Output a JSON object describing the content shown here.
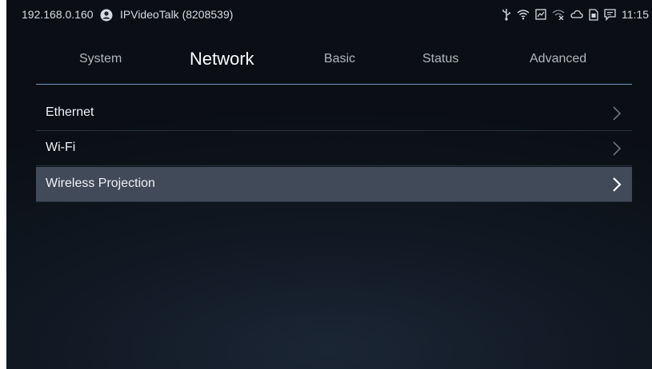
{
  "status_bar": {
    "ip": "192.168.0.160",
    "account_icon": "account-circle-icon",
    "account_label": "IPVideoTalk (8208539)",
    "tray_icons": [
      "usb-icon",
      "wifi-icon",
      "screenshot-icon",
      "wifi-off-icon",
      "cloud-icon",
      "sim-card-icon",
      "message-icon"
    ],
    "time": "11:15"
  },
  "tabs": [
    {
      "label": "System",
      "active": false
    },
    {
      "label": "Network",
      "active": true
    },
    {
      "label": "Basic",
      "active": false
    },
    {
      "label": "Status",
      "active": false
    },
    {
      "label": "Advanced",
      "active": false
    }
  ],
  "menu": {
    "items": [
      {
        "label": "Ethernet",
        "selected": false,
        "icon": "chevron-right-icon"
      },
      {
        "label": "Wi-Fi",
        "selected": false,
        "icon": "chevron-right-icon"
      },
      {
        "label": "Wireless Projection",
        "selected": true,
        "icon": "chevron-right-icon"
      }
    ]
  },
  "colors": {
    "accent_line": "#6f93c2",
    "selected_row": "#404a59",
    "background": "#0b0f15"
  }
}
